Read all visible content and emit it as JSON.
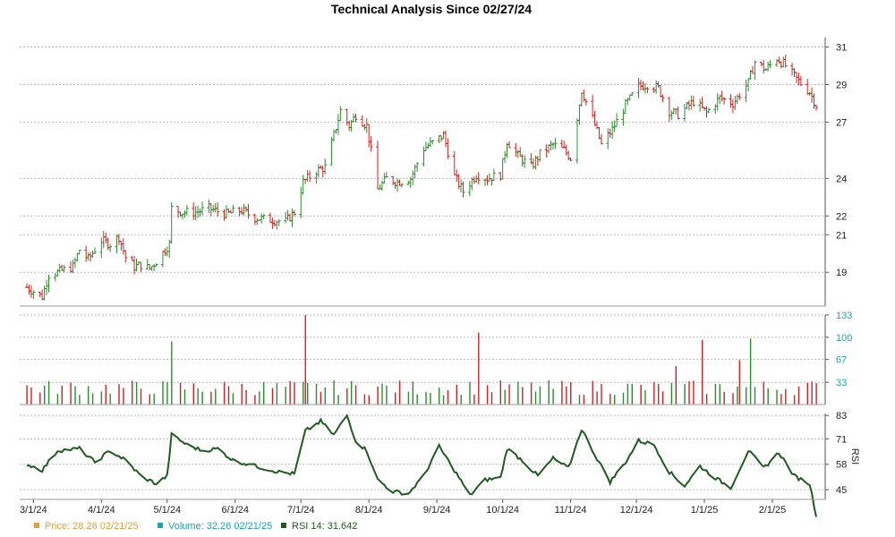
{
  "chart_data": {
    "type": "ohlc",
    "title": "Technical Analysis Since 02/27/24",
    "colors": {
      "up": "#2e8b2e",
      "down": "#cc2222",
      "rsi": "#1f5a1f",
      "volume_axis": "#1aa3b5",
      "price_legend": "#e0a040",
      "grid": "#bbbbbb"
    },
    "grid": true,
    "x_tick_labels": [
      "3/1/24",
      "4/1/24",
      "5/1/24",
      "6/1/24",
      "7/1/24",
      "8/1/24",
      "9/1/24",
      "10/1/24",
      "11/1/24",
      "12/1/24",
      "1/1/25",
      "2/1/25"
    ],
    "x_range": [
      "2024-02-27",
      "2025-02-21"
    ],
    "price_panel": {
      "ylabel": "",
      "yticks": [
        19,
        21,
        22,
        24,
        27,
        29,
        31
      ],
      "ylim": [
        17.2,
        31.5
      ],
      "series": [
        {
          "d": "2024-02-27",
          "c": 18.2
        },
        {
          "d": "2024-03-05",
          "c": 17.7
        },
        {
          "d": "2024-03-08",
          "c": 18.9
        },
        {
          "d": "2024-03-12",
          "c": 19.0
        },
        {
          "d": "2024-03-19",
          "c": 19.3
        },
        {
          "d": "2024-03-22",
          "c": 20.2
        },
        {
          "d": "2024-03-26",
          "c": 19.7
        },
        {
          "d": "2024-04-01",
          "c": 20.7
        },
        {
          "d": "2024-04-05",
          "c": 20.5
        },
        {
          "d": "2024-04-09",
          "c": 20.9
        },
        {
          "d": "2024-04-12",
          "c": 19.8
        },
        {
          "d": "2024-04-16",
          "c": 19.3
        },
        {
          "d": "2024-04-19",
          "c": 19.4
        },
        {
          "d": "2024-04-23",
          "c": 19.2
        },
        {
          "d": "2024-04-26",
          "c": 19.6
        },
        {
          "d": "2024-04-30",
          "c": 20.2
        },
        {
          "d": "2024-05-02",
          "c": 20.5
        },
        {
          "d": "2024-05-03",
          "c": 22.4
        },
        {
          "d": "2024-05-08",
          "c": 22.2
        },
        {
          "d": "2024-05-14",
          "c": 22.2
        },
        {
          "d": "2024-05-20",
          "c": 22.4
        },
        {
          "d": "2024-05-28",
          "c": 22.1
        },
        {
          "d": "2024-06-04",
          "c": 22.3
        },
        {
          "d": "2024-06-10",
          "c": 21.9
        },
        {
          "d": "2024-06-17",
          "c": 21.8
        },
        {
          "d": "2024-06-24",
          "c": 21.7
        },
        {
          "d": "2024-06-28",
          "c": 22.2
        },
        {
          "d": "2024-07-02",
          "c": 23.8
        },
        {
          "d": "2024-07-08",
          "c": 24.4
        },
        {
          "d": "2024-07-12",
          "c": 24.6
        },
        {
          "d": "2024-07-16",
          "c": 26.3
        },
        {
          "d": "2024-07-19",
          "c": 27.6
        },
        {
          "d": "2024-07-23",
          "c": 26.8
        },
        {
          "d": "2024-07-26",
          "c": 27.4
        },
        {
          "d": "2024-07-31",
          "c": 26.8
        },
        {
          "d": "2024-08-05",
          "c": 23.4
        },
        {
          "d": "2024-08-09",
          "c": 24.0
        },
        {
          "d": "2024-08-14",
          "c": 23.8
        },
        {
          "d": "2024-08-20",
          "c": 24.0
        },
        {
          "d": "2024-08-26",
          "c": 25.6
        },
        {
          "d": "2024-08-30",
          "c": 25.9
        },
        {
          "d": "2024-09-04",
          "c": 26.3
        },
        {
          "d": "2024-09-09",
          "c": 24.1
        },
        {
          "d": "2024-09-13",
          "c": 23.3
        },
        {
          "d": "2024-09-19",
          "c": 24.2
        },
        {
          "d": "2024-09-24",
          "c": 24.0
        },
        {
          "d": "2024-09-30",
          "c": 24.2
        },
        {
          "d": "2024-10-03",
          "c": 26.0
        },
        {
          "d": "2024-10-08",
          "c": 25.2
        },
        {
          "d": "2024-10-14",
          "c": 24.6
        },
        {
          "d": "2024-10-18",
          "c": 25.3
        },
        {
          "d": "2024-10-24",
          "c": 25.8
        },
        {
          "d": "2024-10-29",
          "c": 25.5
        },
        {
          "d": "2024-11-01",
          "c": 25.1
        },
        {
          "d": "2024-11-06",
          "c": 28.7
        },
        {
          "d": "2024-11-11",
          "c": 27.2
        },
        {
          "d": "2024-11-15",
          "c": 25.8
        },
        {
          "d": "2024-11-20",
          "c": 26.6
        },
        {
          "d": "2024-11-26",
          "c": 27.9
        },
        {
          "d": "2024-12-02",
          "c": 28.9
        },
        {
          "d": "2024-12-06",
          "c": 29.0
        },
        {
          "d": "2024-12-11",
          "c": 28.8
        },
        {
          "d": "2024-12-16",
          "c": 27.6
        },
        {
          "d": "2024-12-20",
          "c": 27.4
        },
        {
          "d": "2024-12-27",
          "c": 28.1
        },
        {
          "d": "2025-01-02",
          "c": 27.5
        },
        {
          "d": "2025-01-08",
          "c": 28.3
        },
        {
          "d": "2025-01-14",
          "c": 28.0
        },
        {
          "d": "2025-01-21",
          "c": 29.1
        },
        {
          "d": "2025-01-24",
          "c": 30.2
        },
        {
          "d": "2025-01-29",
          "c": 29.8
        },
        {
          "d": "2025-02-03",
          "c": 30.4
        },
        {
          "d": "2025-02-07",
          "c": 30.0
        },
        {
          "d": "2025-02-12",
          "c": 29.3
        },
        {
          "d": "2025-02-18",
          "c": 28.6
        },
        {
          "d": "2025-02-21",
          "c": 27.9
        }
      ]
    },
    "volume_panel": {
      "yticks": [
        33,
        67,
        100,
        133
      ],
      "ylim": [
        0,
        133
      ],
      "spikes": [
        {
          "d": "2024-05-03",
          "v": 94
        },
        {
          "d": "2024-07-03",
          "v": 133
        },
        {
          "d": "2024-09-20",
          "v": 107
        },
        {
          "d": "2024-12-19",
          "v": 57
        },
        {
          "d": "2024-12-31",
          "v": 96
        },
        {
          "d": "2025-01-22",
          "v": 98
        },
        {
          "d": "2025-01-17",
          "v": 66
        }
      ],
      "base_level": 25
    },
    "rsi_panel": {
      "ylabel": "RSI",
      "yticks": [
        45,
        58,
        71,
        83
      ],
      "ylim": [
        40,
        84
      ],
      "series": [
        {
          "d": "2024-02-27",
          "v": 58
        },
        {
          "d": "2024-03-05",
          "v": 55
        },
        {
          "d": "2024-03-12",
          "v": 65
        },
        {
          "d": "2024-03-22",
          "v": 66
        },
        {
          "d": "2024-03-29",
          "v": 59
        },
        {
          "d": "2024-04-05",
          "v": 65
        },
        {
          "d": "2024-04-12",
          "v": 60
        },
        {
          "d": "2024-04-19",
          "v": 52
        },
        {
          "d": "2024-04-26",
          "v": 48
        },
        {
          "d": "2024-05-01",
          "v": 52
        },
        {
          "d": "2024-05-03",
          "v": 73
        },
        {
          "d": "2024-05-10",
          "v": 68
        },
        {
          "d": "2024-05-17",
          "v": 65
        },
        {
          "d": "2024-05-24",
          "v": 66
        },
        {
          "d": "2024-05-31",
          "v": 60
        },
        {
          "d": "2024-06-07",
          "v": 58
        },
        {
          "d": "2024-06-14",
          "v": 56
        },
        {
          "d": "2024-06-21",
          "v": 54
        },
        {
          "d": "2024-06-28",
          "v": 53
        },
        {
          "d": "2024-07-03",
          "v": 75
        },
        {
          "d": "2024-07-10",
          "v": 80
        },
        {
          "d": "2024-07-16",
          "v": 73
        },
        {
          "d": "2024-07-22",
          "v": 83
        },
        {
          "d": "2024-07-26",
          "v": 70
        },
        {
          "d": "2024-07-31",
          "v": 65
        },
        {
          "d": "2024-08-05",
          "v": 50
        },
        {
          "d": "2024-08-12",
          "v": 44
        },
        {
          "d": "2024-08-19",
          "v": 43
        },
        {
          "d": "2024-08-26",
          "v": 52
        },
        {
          "d": "2024-09-02",
          "v": 67
        },
        {
          "d": "2024-09-09",
          "v": 55
        },
        {
          "d": "2024-09-16",
          "v": 42
        },
        {
          "d": "2024-09-23",
          "v": 50
        },
        {
          "d": "2024-09-30",
          "v": 51
        },
        {
          "d": "2024-10-03",
          "v": 66
        },
        {
          "d": "2024-10-10",
          "v": 60
        },
        {
          "d": "2024-10-17",
          "v": 52
        },
        {
          "d": "2024-10-24",
          "v": 61
        },
        {
          "d": "2024-10-31",
          "v": 56
        },
        {
          "d": "2024-11-06",
          "v": 76
        },
        {
          "d": "2024-11-12",
          "v": 63
        },
        {
          "d": "2024-11-19",
          "v": 49
        },
        {
          "d": "2024-11-26",
          "v": 59
        },
        {
          "d": "2024-12-02",
          "v": 70
        },
        {
          "d": "2024-12-09",
          "v": 68
        },
        {
          "d": "2024-12-16",
          "v": 54
        },
        {
          "d": "2024-12-23",
          "v": 47
        },
        {
          "d": "2024-12-30",
          "v": 57
        },
        {
          "d": "2025-01-06",
          "v": 51
        },
        {
          "d": "2025-01-13",
          "v": 46
        },
        {
          "d": "2025-01-21",
          "v": 65
        },
        {
          "d": "2025-01-28",
          "v": 56
        },
        {
          "d": "2025-02-04",
          "v": 64
        },
        {
          "d": "2025-02-11",
          "v": 52
        },
        {
          "d": "2025-02-18",
          "v": 48
        },
        {
          "d": "2025-02-21",
          "v": 32
        }
      ]
    },
    "legend": [
      {
        "label": "Price: 28.26  02/21/25",
        "color_key": "price_legend"
      },
      {
        "label": "Volume: 32.26  02/21/25",
        "color_key": "volume_axis"
      },
      {
        "label": "RSI 14: 31.642",
        "color_key": "rsi"
      }
    ]
  }
}
